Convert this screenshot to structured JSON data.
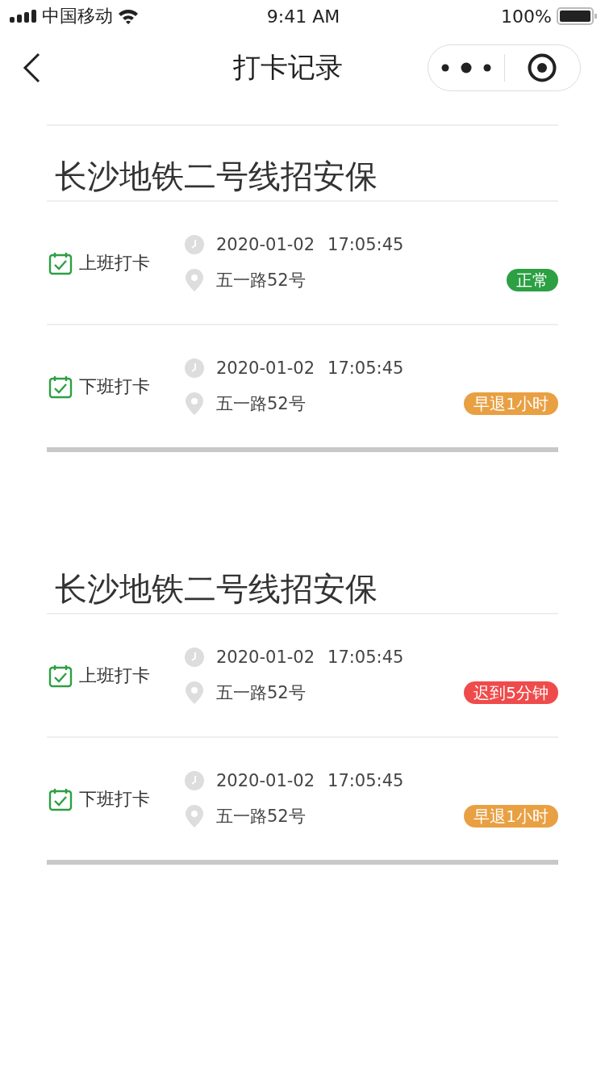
{
  "status_bar": {
    "carrier": "中国移动",
    "time": "9:41 AM",
    "battery": "100%"
  },
  "nav": {
    "title": "打卡记录"
  },
  "groups": [
    {
      "title": "长沙地铁二号线招安保",
      "records": [
        {
          "label": "上班打卡",
          "date": "2020-01-02",
          "time": "17:05:45",
          "address": "五一路52号",
          "status": "正常",
          "color": "#2ca043"
        },
        {
          "label": "下班打卡",
          "date": "2020-01-02",
          "time": "17:05:45",
          "address": "五一路52号",
          "status": "早退1小时",
          "color": "#e8a043"
        }
      ]
    },
    {
      "title": "长沙地铁二号线招安保",
      "records": [
        {
          "label": "上班打卡",
          "date": "2020-01-02",
          "time": "17:05:45",
          "address": "五一路52号",
          "status": "迟到5分钟",
          "color": "#f04b4b"
        },
        {
          "label": "下班打卡",
          "date": "2020-01-02",
          "time": "17:05:45",
          "address": "五一路52号",
          "status": "早退1小时",
          "color": "#e8a043"
        }
      ]
    }
  ]
}
